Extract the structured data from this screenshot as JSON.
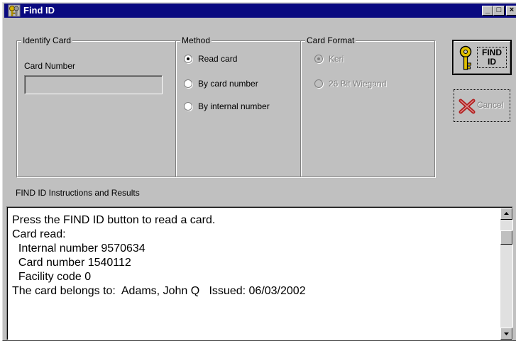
{
  "window": {
    "title": "Find ID",
    "icon": "key-icon"
  },
  "title_buttons": {
    "minimize": "_",
    "maximize": "□",
    "close": "×"
  },
  "identify_card": {
    "legend": "Identify Card",
    "card_number_label": "Card Number",
    "card_number_value": ""
  },
  "method": {
    "legend": "Method",
    "options": [
      {
        "label": "Read card",
        "selected": true
      },
      {
        "label": "By card number",
        "selected": false
      },
      {
        "label": "By internal number",
        "selected": false
      }
    ]
  },
  "card_format": {
    "legend": "Card Format",
    "options": [
      {
        "label": "Keri",
        "selected": true,
        "enabled": false
      },
      {
        "label": "26 Bit Wiegand",
        "selected": false,
        "enabled": false
      }
    ]
  },
  "buttons": {
    "find_line1": "FIND",
    "find_line2": "ID",
    "cancel": "Cancel"
  },
  "results": {
    "label": "FIND ID Instructions and Results",
    "lines": [
      "Press the FIND ID button to read a card.",
      "Card read:",
      "  Internal number 9570634",
      "  Card number 1540112",
      "  Facility code 0",
      "The card belongs to:  Adams, John Q   Issued: 06/03/2002"
    ]
  },
  "colors": {
    "title_bar": "#0a0a80",
    "face": "#c0c0c0",
    "disabled_text": "#808080",
    "cancel_x": "#b02020",
    "key": "#a08000"
  }
}
